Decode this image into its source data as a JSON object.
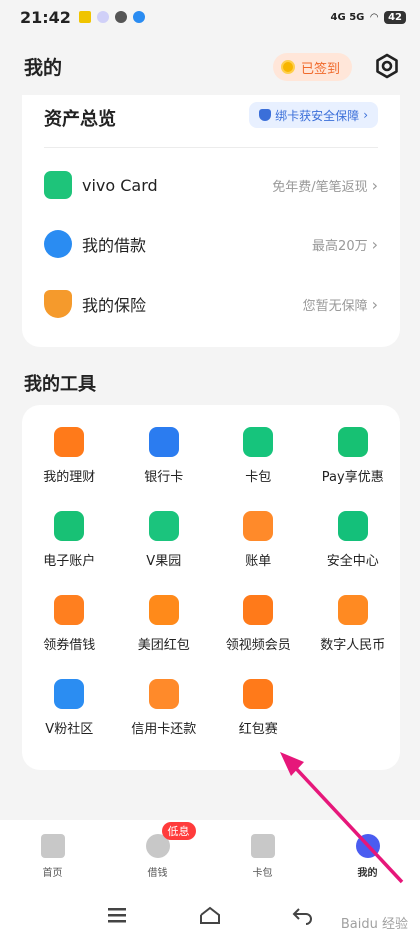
{
  "status": {
    "time": "21:42",
    "network": "4G 5G",
    "battery": "42"
  },
  "header": {
    "title": "我的",
    "signin": "已签到"
  },
  "assets": {
    "title": "资产总览",
    "bind_card": "绑卡获安全保障",
    "rows": [
      {
        "label": "vivo Card",
        "hint": "免年费/笔笔返现",
        "icon": "card-icon",
        "color": "#1ec47a"
      },
      {
        "label": "我的借款",
        "hint": "最高20万",
        "icon": "loan-icon",
        "color": "#2a8cf2"
      },
      {
        "label": "我的保险",
        "hint": "您暂无保障",
        "icon": "insurance-icon",
        "color": "#f59a2c"
      }
    ]
  },
  "tools": {
    "title": "我的工具",
    "items": [
      {
        "label": "我的理财",
        "icon": "wealth-icon",
        "color": "#ff7a1a"
      },
      {
        "label": "银行卡",
        "icon": "bank-card-icon",
        "color": "#2b7cf0"
      },
      {
        "label": "卡包",
        "icon": "card-pack-icon",
        "color": "#16c47c"
      },
      {
        "label": "Pay享优惠",
        "icon": "pay-discount-icon",
        "color": "#17c173"
      },
      {
        "label": "电子账户",
        "icon": "e-account-icon",
        "color": "#18c175"
      },
      {
        "label": "V果园",
        "icon": "orchard-icon",
        "color": "#1bc47d"
      },
      {
        "label": "账单",
        "icon": "bill-icon",
        "color": "#ff8a2a"
      },
      {
        "label": "安全中心",
        "icon": "security-icon",
        "color": "#14c07a"
      },
      {
        "label": "领券借钱",
        "icon": "coupon-icon",
        "color": "#ff7f1f"
      },
      {
        "label": "美团红包",
        "icon": "meituan-icon",
        "color": "#ff8a1a"
      },
      {
        "label": "领视频会员",
        "icon": "video-vip-icon",
        "color": "#ff7a1a"
      },
      {
        "label": "数字人民币",
        "icon": "digital-rmb-icon",
        "color": "#ff8a22"
      },
      {
        "label": "V粉社区",
        "icon": "community-icon",
        "color": "#2b8df2"
      },
      {
        "label": "信用卡还款",
        "icon": "credit-repay-icon",
        "color": "#ff8a2a"
      },
      {
        "label": "红包赛",
        "icon": "red-packet-icon",
        "color": "#ff7a1a"
      }
    ]
  },
  "nav": {
    "items": [
      {
        "label": "首页",
        "icon": "home-icon"
      },
      {
        "label": "借钱",
        "icon": "borrow-icon",
        "badge": "低息"
      },
      {
        "label": "卡包",
        "icon": "wallet-icon"
      },
      {
        "label": "我的",
        "icon": "profile-icon",
        "active": true
      }
    ]
  },
  "colors": {
    "accent": "#4a5cf0",
    "arrow": "#e6177a"
  },
  "watermark": "Baidu 经验"
}
